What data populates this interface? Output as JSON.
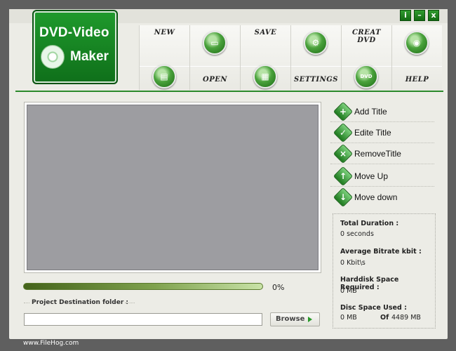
{
  "window_buttons": {
    "info": "i",
    "minimize": "–",
    "close": "x"
  },
  "logo": {
    "line1": "DVD-Video",
    "line2": "Maker"
  },
  "toolbar": {
    "new": "NEW",
    "open": "OPEN",
    "save": "SAVE",
    "settings": "SETTINGS",
    "create_dvd": "CREAT DVD",
    "help": "HELP",
    "dvd_icon_text": "DVD"
  },
  "actions": [
    {
      "label": "Add Title",
      "icon": "add-icon"
    },
    {
      "label": "Edite Title",
      "icon": "check-icon"
    },
    {
      "label": "RemoveTitle",
      "icon": "remove-icon"
    },
    {
      "label": "Move Up",
      "icon": "arrow-up-icon"
    },
    {
      "label": "Move down",
      "icon": "arrow-down-icon"
    }
  ],
  "progress": {
    "value": 0.0,
    "label": "0%"
  },
  "destination": {
    "label": "Project Destination folder :",
    "value": "",
    "browse_label": "Browse"
  },
  "info": {
    "total_duration_label": "Total Duration :",
    "total_duration_value": "0 seconds",
    "bitrate_label": "Average Bitrate kbit :",
    "bitrate_value": "0 Kbit\\s",
    "harddisk_label": "Harddisk Space Required :",
    "harddisk_value": "0 MB",
    "disc_label": "Disc Space Used :",
    "disc_used_value": "0 MB",
    "disc_of_label": "Of",
    "disc_total_value": "4489 MB"
  },
  "footer": "www.FileHog.com",
  "colors": {
    "accent_green": "#1f9a2c",
    "frame_gray": "#5f5f5f",
    "panel_bg": "#ecece6"
  }
}
